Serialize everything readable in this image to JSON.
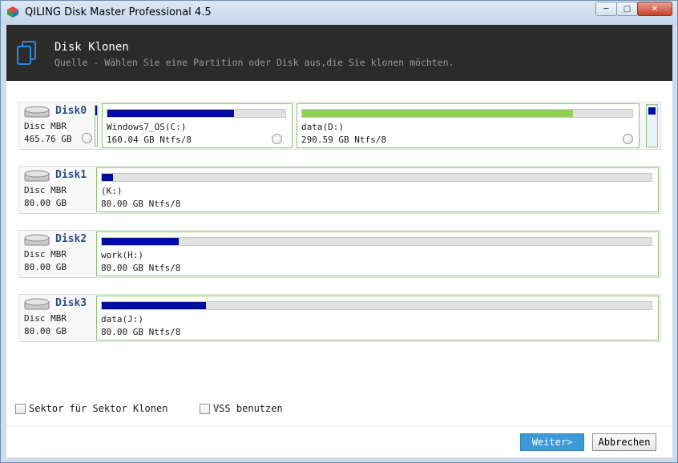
{
  "window": {
    "title": "QILING Disk Master Professional 4.5",
    "buttons": {
      "minimize": "─",
      "maximize": "□",
      "close": "✕"
    }
  },
  "header": {
    "title": "Disk Klonen",
    "subtitle": "Quelle - Wählen Sie eine Partition oder Disk aus,die Sie klonen möchten."
  },
  "disks": [
    {
      "name": "Disk0",
      "type": "Disc MBR",
      "size": "465.76 GB",
      "partitions": [
        {
          "label": "Windows7_OS(C:)",
          "size": "160.04 GB Ntfs/8",
          "used_fraction": 0.71,
          "color": "#000ea0"
        },
        {
          "label": "data(D:)",
          "size": "290.59 GB Ntfs/8",
          "used_fraction": 0.82,
          "color": "#8fd052"
        }
      ]
    },
    {
      "name": "Disk1",
      "type": "Disc MBR",
      "size": "80.00 GB",
      "partitions": [
        {
          "label": "(K:)",
          "size": "80.00 GB Ntfs/8",
          "used_fraction": 0.02,
          "color": "#000ea0"
        }
      ]
    },
    {
      "name": "Disk2",
      "type": "Disc MBR",
      "size": "80.00 GB",
      "partitions": [
        {
          "label": "work(H:)",
          "size": "80.00 GB Ntfs/8",
          "used_fraction": 0.14,
          "color": "#000ea0"
        }
      ]
    },
    {
      "name": "Disk3",
      "type": "Disc MBR",
      "size": "80.00 GB",
      "partitions": [
        {
          "label": "data(J:)",
          "size": "80.00 GB Ntfs/8",
          "used_fraction": 0.19,
          "color": "#000ea0"
        }
      ]
    }
  ],
  "options": {
    "sector_clone": "Sektor für Sektor Klonen",
    "vss": "VSS benutzen"
  },
  "footer": {
    "next": "Weiter>",
    "cancel": "Abbrechen"
  },
  "colors": {
    "accent": "#3c9ad9",
    "header_bg": "#2b2b2c",
    "partition_border": "#8fc27a"
  }
}
